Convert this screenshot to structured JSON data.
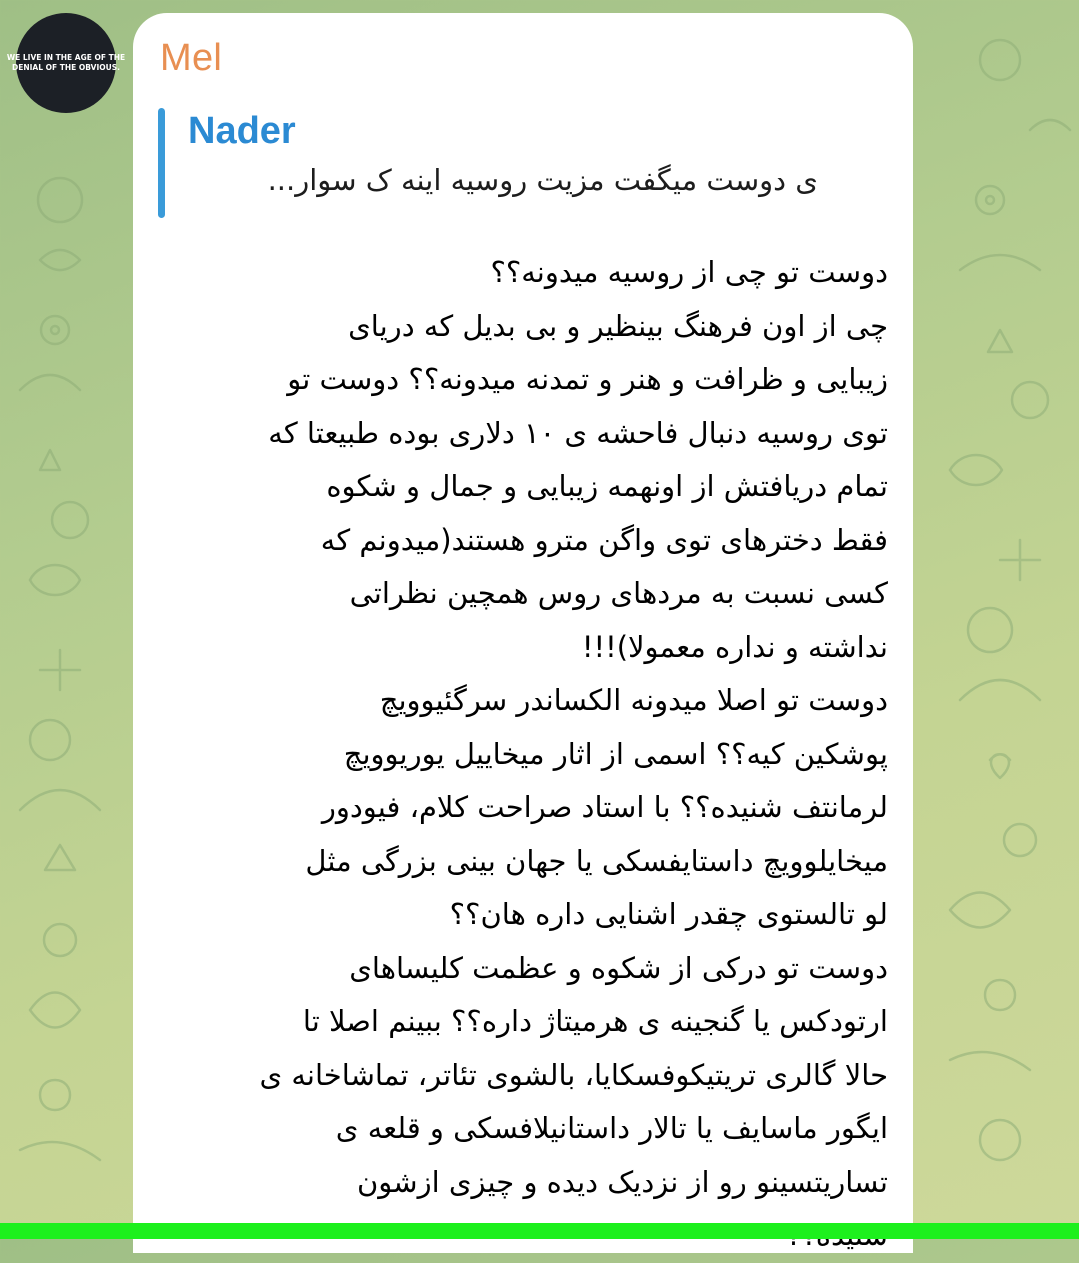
{
  "avatar": {
    "lines": [
      "WE LIVE IN THE AGE OF THE",
      "DENIAL OF THE OBVIOUS."
    ]
  },
  "message": {
    "sender": "Mel",
    "reply": {
      "author": "Nader",
      "text": "ی دوست میگفت مزیت روسیه اینه ک سوار..."
    },
    "lines": [
      "دوست تو چی از روسیه میدونه؟؟",
      "چی از اون فرهنگ بینظیر و بی بدیل که دریای",
      "زیبایی و ظرافت و هنر و تمدنه میدونه؟؟ دوست تو",
      "توی روسیه دنبال فاحشه ی ۱۰ دلاری بوده طبیعتا که",
      "تمام دریافتش از اونهمه زیبایی و جمال و شکوه",
      "فقط دخترهای توی واگن مترو هستند(میدونم که",
      "کسی نسبت به مردهای روس همچین نظراتی",
      "نداشته و نداره معمولا)!!!",
      "دوست تو اصلا میدونه الکساندر سرگئیوویچ",
      "پوشکین کیه؟؟ اسمی از اثار میخاییل یوریوویچ",
      "لرمانتف شنیده؟؟ با استاد صراحت کلام، فیودور",
      "میخایلوویچ داستایفسکی یا جهان بینی بزرگی مثل",
      "لو تالستوی چقدر اشنایی داره هان؟؟",
      "دوست تو درکی از شکوه و عظمت کلیساهای",
      "ارتودکس یا گنجینه ی هرمیتاژ داره؟؟ ببینم اصلا تا",
      "حالا گالری تریتیکوفسکایا، بالشوی تئاتر، تماشاخانه ی",
      "ایگور ماسایف یا تالار داستانیلافسکی و قلعه ی",
      "تساریتسینو رو از نزدیک دیده و چیزی ازشون",
      "شنیده؟؟"
    ]
  },
  "colors": {
    "sender": "#e88f52",
    "reply_author": "#2b8ad3",
    "reply_bar": "#3a9bd9",
    "bottom_bar": "#1df01d"
  }
}
